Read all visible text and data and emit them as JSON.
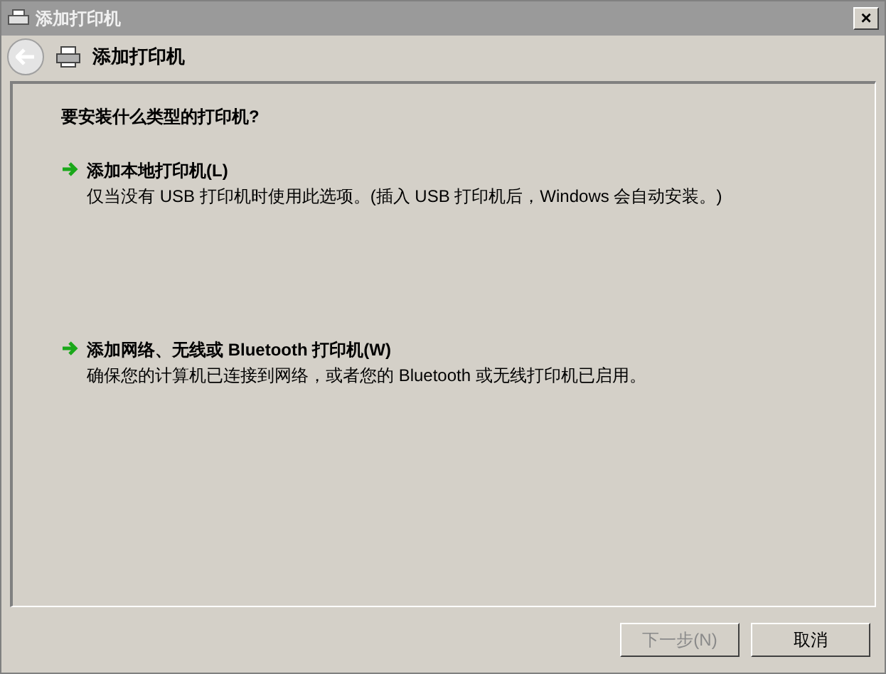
{
  "window": {
    "title": "添加打印机",
    "close": "×"
  },
  "header": {
    "title": "添加打印机"
  },
  "question": "要安装什么类型的打印机?",
  "options": [
    {
      "title": "添加本地打印机(L)",
      "description": "仅当没有 USB 打印机时使用此选项。(插入 USB 打印机后，Windows 会自动安装。)"
    },
    {
      "title": "添加网络、无线或 Bluetooth 打印机(W)",
      "description": "确保您的计算机已连接到网络，或者您的 Bluetooth 或无线打印机已启用。"
    }
  ],
  "buttons": [
    {
      "label": "下一步(N)",
      "disabled": true
    },
    {
      "label": "取消",
      "disabled": false
    }
  ]
}
